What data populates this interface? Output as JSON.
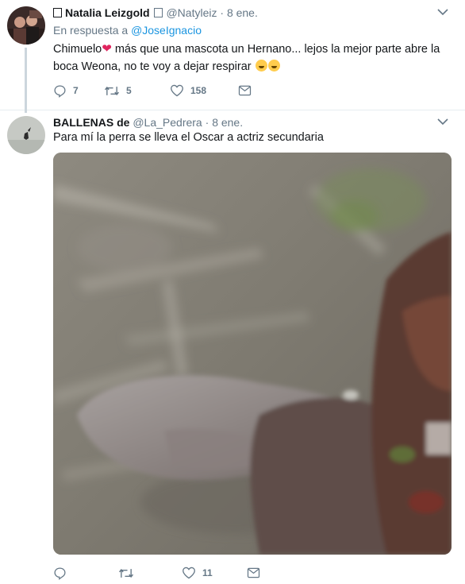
{
  "tweets": [
    {
      "author_name": "Natalia Leizgold",
      "handle": "@Natyleiz",
      "separator": "·",
      "time": "8 ene.",
      "reply_prefix": "En respuesta a",
      "reply_to": "@JoseIgnacio",
      "text_part1": "Chimuelo",
      "text_part2": " más que una mascota un Hernano... lejos la mejor parte abre la boca Weona, no te voy a dejar respirar ",
      "emoji": [
        "heart",
        "laughing-tears",
        "laughing-tears"
      ],
      "counts": {
        "reply": "7",
        "retweet": "5",
        "like": "158"
      }
    },
    {
      "author_name": "BALLENAS de",
      "handle": "@La_Pedrera",
      "separator": "·",
      "time": "8 ene.",
      "text": "Para mí la perra se lleva el Oscar a actriz secundaria",
      "media": "video-frame",
      "counts": {
        "reply": "",
        "retweet": "",
        "like": "11"
      }
    }
  ],
  "colors": {
    "text": "#14171a",
    "secondary": "#657786",
    "link": "#1b95e0",
    "divider": "#e6ecf0",
    "thread_line": "#ccd6dd"
  },
  "icons": [
    "reply-icon",
    "retweet-icon",
    "like-icon",
    "message-icon",
    "caret-down-icon"
  ]
}
